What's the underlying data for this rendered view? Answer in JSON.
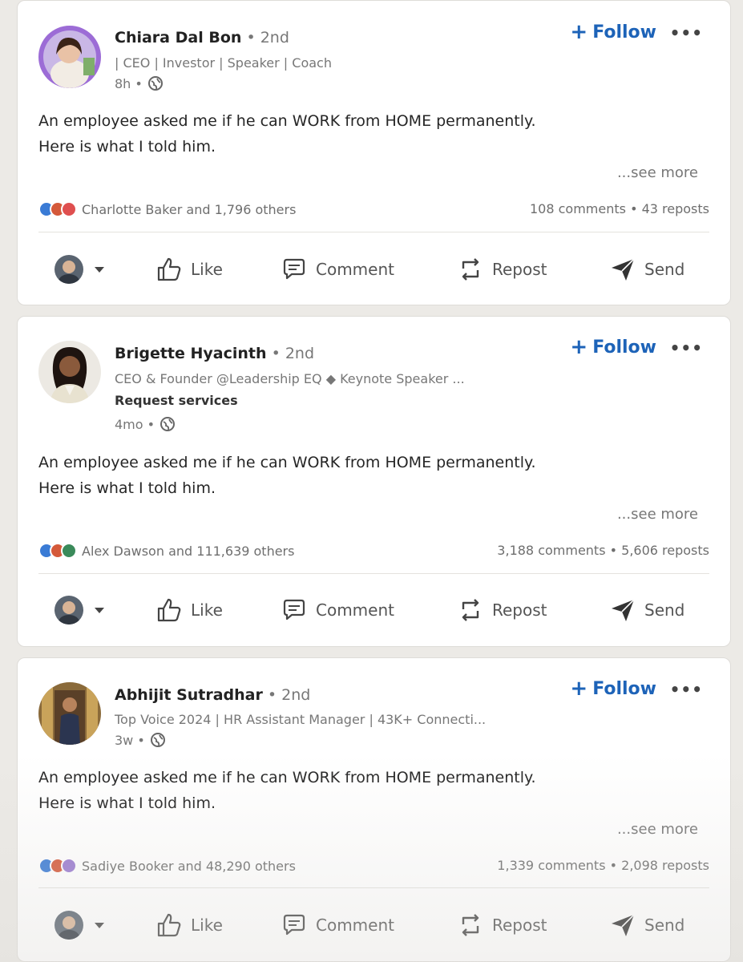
{
  "posts": [
    {
      "author": "Chiara Dal Bon",
      "degree": "2nd",
      "headline": "| CEO | Investor | Speaker | Coach",
      "cta": "",
      "time": "8h",
      "follow_label": "Follow",
      "body_line1": "An employee asked me if he can WORK from HOME permanently.",
      "body_line2": "Here is what I told him.",
      "see_more": "...see more",
      "reactions_text": "Charlotte Baker and 1,796 others",
      "reaction_icons": [
        "like",
        "celebrate",
        "love"
      ],
      "comments_reposts": "108 comments • 43 reposts"
    },
    {
      "author": "Brigette Hyacinth",
      "degree": "2nd",
      "headline": "CEO & Founder @Leadership EQ ◆ Keynote Speaker ...",
      "cta": "Request services",
      "time": "4mo",
      "follow_label": "Follow",
      "body_line1": "An employee asked me if he can WORK from HOME permanently.",
      "body_line2": "Here is what I told him.",
      "see_more": "...see more",
      "reactions_text": "Alex Dawson and 111,639 others",
      "reaction_icons": [
        "like",
        "celebrate",
        "support"
      ],
      "comments_reposts": "3,188 comments • 5,606 reposts"
    },
    {
      "author": "Abhijit Sutradhar",
      "degree": "2nd",
      "headline": "Top Voice 2024 | HR Assistant Manager | 43K+ Connecti...",
      "cta": "",
      "time": "3w",
      "follow_label": "Follow",
      "body_line1": "An employee asked me if he can WORK from HOME permanently.",
      "body_line2": "Here is what I told him.",
      "see_more": "...see more",
      "reactions_text": "Sadiye Booker and 48,290 others",
      "reaction_icons": [
        "like",
        "celebrate",
        "funny"
      ],
      "comments_reposts": "1,339 comments • 2,098 reposts"
    }
  ],
  "actions": {
    "like": "Like",
    "comment": "Comment",
    "repost": "Repost",
    "send": "Send"
  },
  "colors": {
    "accent": "#1d63b8",
    "like": "#3a7bd5",
    "celebrate": "#d4593a",
    "love": "#df4f4f",
    "support": "#3a8a5a",
    "funny": "#9a7bd0"
  }
}
